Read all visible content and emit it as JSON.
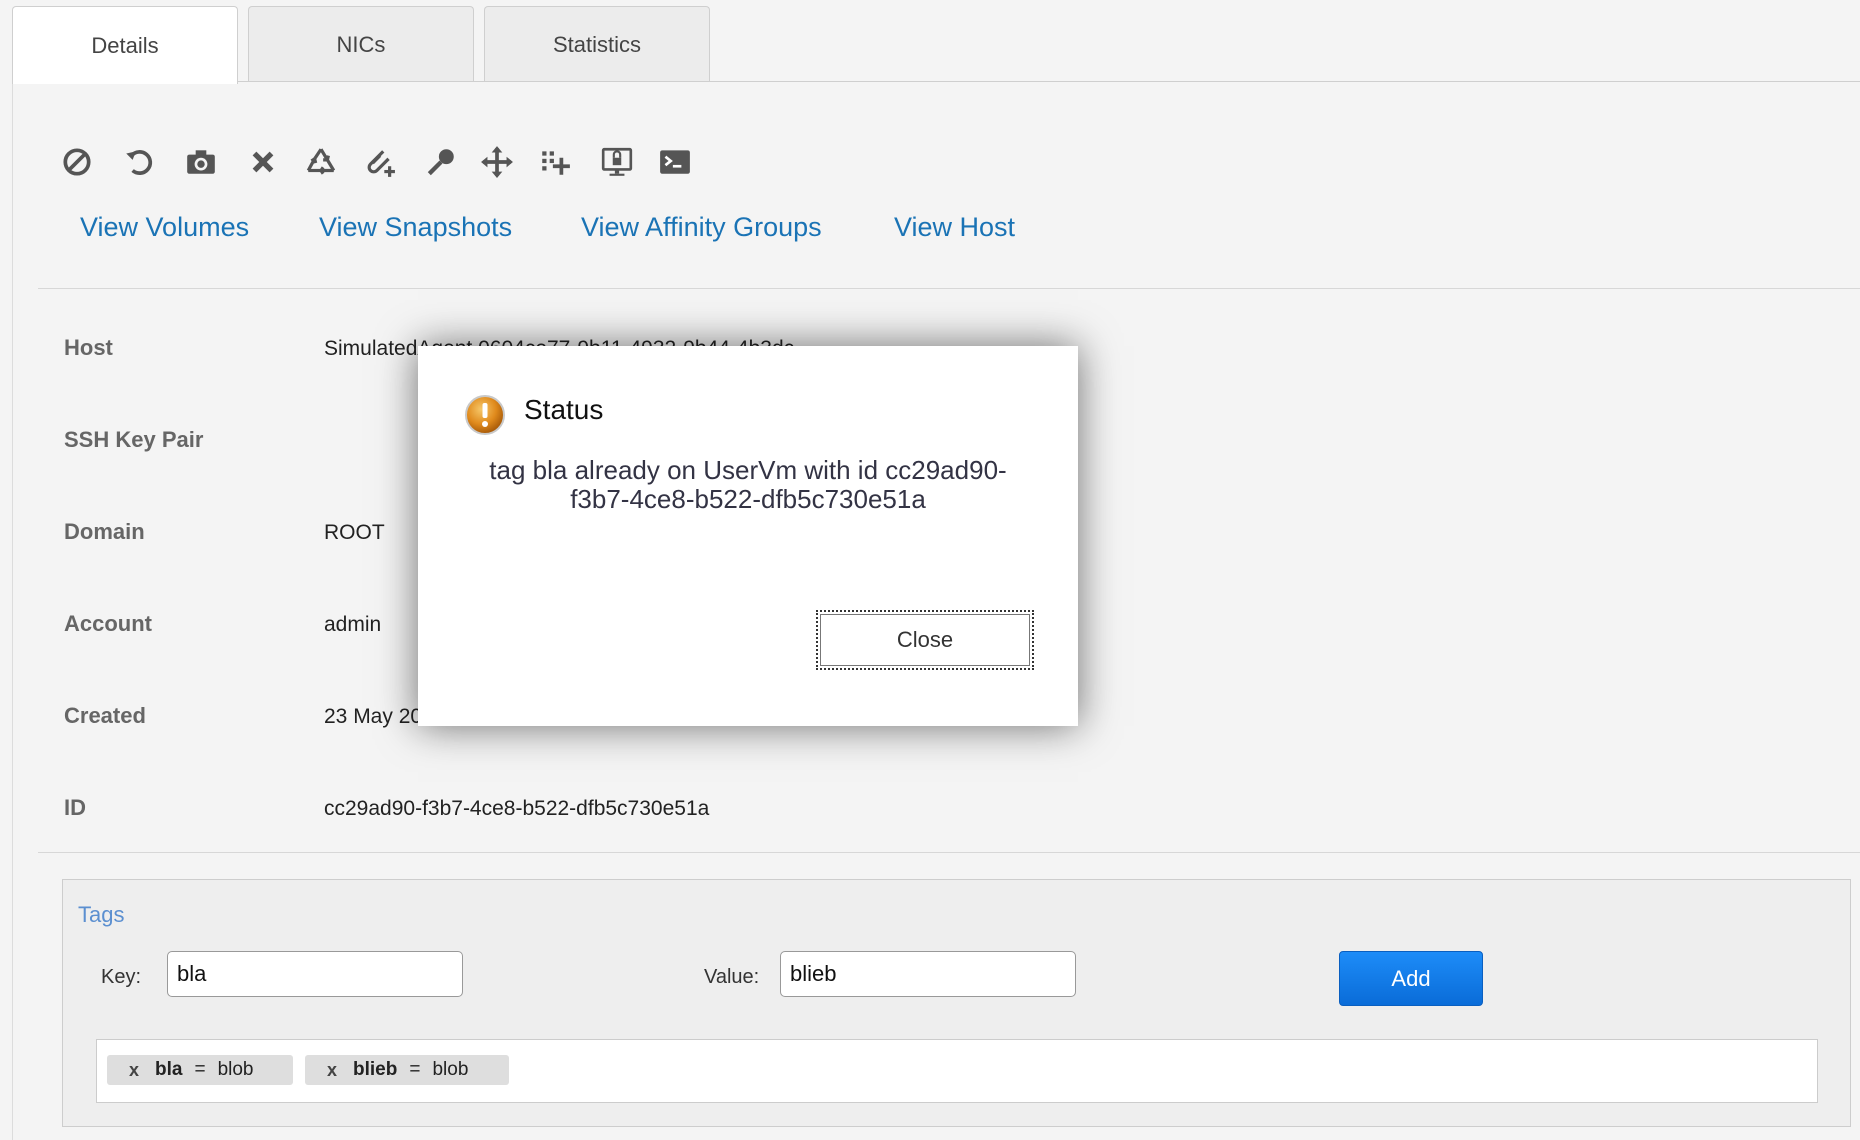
{
  "tabs": [
    {
      "label": "Details"
    },
    {
      "label": "NICs"
    },
    {
      "label": "Statistics"
    }
  ],
  "toolbar_icons": [
    "stop-icon",
    "reboot-icon",
    "snapshot-icon",
    "destroy-icon",
    "recycle-icon",
    "attach-iso-icon",
    "reset-key-icon",
    "migrate-icon",
    "scale-icon",
    "console-icon",
    "terminal-icon"
  ],
  "view_links": {
    "volumes": "View Volumes",
    "snapshots": "View Snapshots",
    "affinity": "View Affinity Groups",
    "host": "View Host"
  },
  "details": {
    "host": {
      "label": "Host",
      "value": "SimulatedAgent.0604ce77-9b11-4932-9b44-4b3dc"
    },
    "ssh": {
      "label": "SSH Key Pair",
      "value": ""
    },
    "domain": {
      "label": "Domain",
      "value": "ROOT"
    },
    "account": {
      "label": "Account",
      "value": "admin"
    },
    "created": {
      "label": "Created",
      "value": "23 May 2020"
    },
    "id": {
      "label": "ID",
      "value": "cc29ad90-f3b7-4ce8-b522-dfb5c730e51a"
    }
  },
  "tags": {
    "title": "Tags",
    "key_label": "Key:",
    "key_value": "bla",
    "value_label": "Value:",
    "value_value": "blieb",
    "add_label": "Add",
    "items": [
      {
        "remove": "x",
        "key": "bla",
        "eq": "=",
        "value": "blob"
      },
      {
        "remove": "x",
        "key": "blieb",
        "eq": "=",
        "value": "blob"
      }
    ]
  },
  "dialog": {
    "title": "Status",
    "message_line1": "tag bla already on UserVm with id cc29ad90-",
    "message_line2": "f3b7-4ce8-b522-dfb5c730e51a",
    "close_label": "Close"
  },
  "colors": {
    "link": "#1a73b5",
    "add_button": "#0a6cd8",
    "tags_title": "#5b8fd0"
  }
}
